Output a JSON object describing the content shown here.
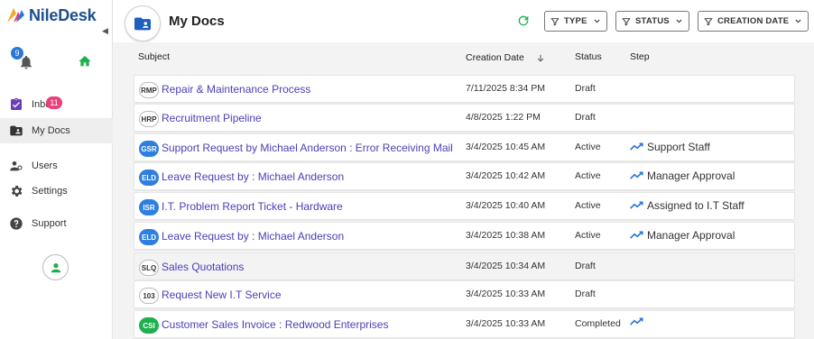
{
  "app": {
    "name": "NileDesk"
  },
  "sidebar": {
    "notifications_count": "9",
    "inbox_count": "11",
    "items": [
      {
        "label": "Inbox",
        "icon": "inbox-icon"
      },
      {
        "label": "My Docs",
        "icon": "folder-user-icon",
        "active": true
      },
      {
        "label": "Users",
        "icon": "users-icon"
      },
      {
        "label": "Settings",
        "icon": "gear-icon"
      },
      {
        "label": "Support",
        "icon": "help-icon"
      }
    ]
  },
  "header": {
    "title": "My Docs",
    "filters": [
      "TYPE",
      "STATUS",
      "CREATION DATE"
    ]
  },
  "table": {
    "columns": {
      "subject": "Subject",
      "creation_date": "Creation Date",
      "status": "Status",
      "step": "Step"
    },
    "rows": [
      {
        "badge": "RMP",
        "badge_style": "outline",
        "subject": "Repair & Maintenance Process",
        "date": "7/11/2025 8:34 PM",
        "status": "Draft",
        "step": ""
      },
      {
        "badge": "HRP",
        "badge_style": "outline",
        "subject": "Recruitment Pipeline",
        "date": "4/8/2025 1:22 PM",
        "status": "Draft",
        "step": ""
      },
      {
        "badge": "GSR",
        "badge_style": "blue",
        "subject": "Support Request by Michael Anderson : Error Receiving Mail",
        "date": "3/4/2025 10:45 AM",
        "status": "Active",
        "step": "Support Staff"
      },
      {
        "badge": "ELD",
        "badge_style": "blue",
        "subject": "Leave Request by : Michael Anderson",
        "date": "3/4/2025 10:42 AM",
        "status": "Active",
        "step": "Manager Approval"
      },
      {
        "badge": "ISR",
        "badge_style": "blue",
        "subject": "I.T. Problem Report Ticket - Hardware",
        "date": "3/4/2025 10:40 AM",
        "status": "Active",
        "step": "Assigned to I.T Staff"
      },
      {
        "badge": "ELD",
        "badge_style": "blue",
        "subject": "Leave Request by : Michael Anderson",
        "date": "3/4/2025 10:38 AM",
        "status": "Active",
        "step": "Manager Approval"
      },
      {
        "badge": "SLQ",
        "badge_style": "outline",
        "subject": "Sales Quotations",
        "date": "3/4/2025 10:34 AM",
        "status": "Draft",
        "step": ""
      },
      {
        "badge": "103",
        "badge_style": "outline",
        "subject": "Request New I.T Service",
        "date": "3/4/2025 10:33 AM",
        "status": "Draft",
        "step": ""
      },
      {
        "badge": "CSI",
        "badge_style": "green",
        "subject": "Customer Sales Invoice : Redwood Enterprises",
        "date": "3/4/2025 10:33 AM",
        "status": "Completed",
        "step": ""
      }
    ]
  },
  "colors": {
    "accent": "#2b78d8",
    "link": "#4a3fb8",
    "active_bg": "#eeeeee",
    "badge_pink": "#e8417b",
    "success": "#1fb04e"
  }
}
